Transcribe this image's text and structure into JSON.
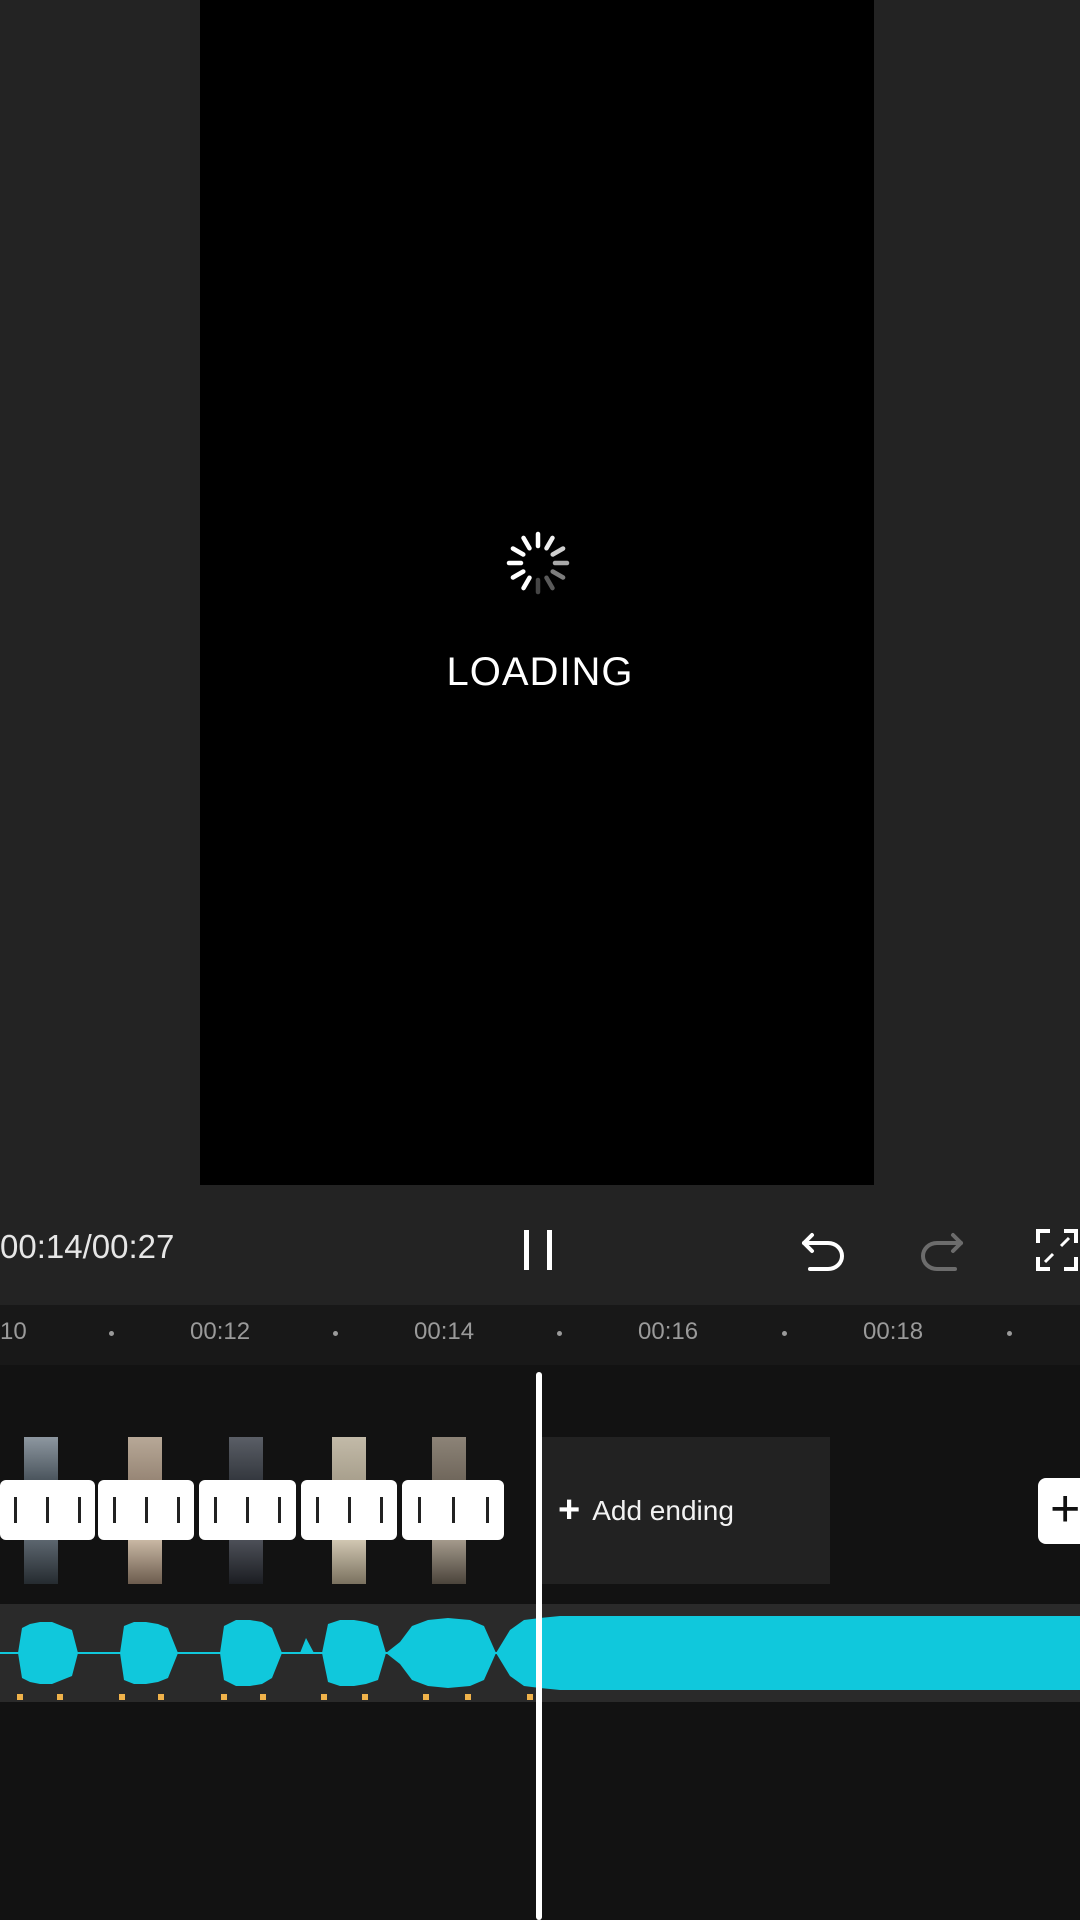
{
  "preview": {
    "loading_text": "LOADING"
  },
  "controls": {
    "timecode": "00:14/00:27",
    "play_pause_icon": "pause-icon",
    "undo_icon": "undo-icon",
    "redo_icon": "redo-icon",
    "fullscreen_icon": "fullscreen-icon"
  },
  "ruler": {
    "labels": [
      "10",
      "00:12",
      "00:14",
      "00:16",
      "00:18"
    ]
  },
  "timeline": {
    "add_ending_label": "Add ending",
    "add_clip_icon": "plus-icon"
  },
  "colors": {
    "audio_waveform": "#10c8dc",
    "beat_marker": "#f0b24a",
    "background": "#1f1f1f"
  }
}
